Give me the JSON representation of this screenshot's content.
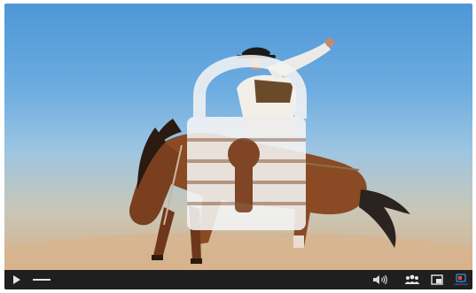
{
  "player": {
    "video": {
      "subject": "bucking-bronco-rodeo",
      "overlay_icon": "lock-icon",
      "locked": true
    },
    "controls": {
      "play_icon": "play-icon",
      "volume_icon": "volume-icon",
      "participants_icon": "people-icon",
      "pip_icon": "picture-in-picture-icon",
      "cast_icon": "cast-icon",
      "cast_label": "Live Event",
      "progress_fraction": 0.0
    },
    "colors": {
      "control_bar": "#1f1f1f",
      "icon": "#e6e6e6",
      "cast_accent": "#3a8de0"
    }
  }
}
